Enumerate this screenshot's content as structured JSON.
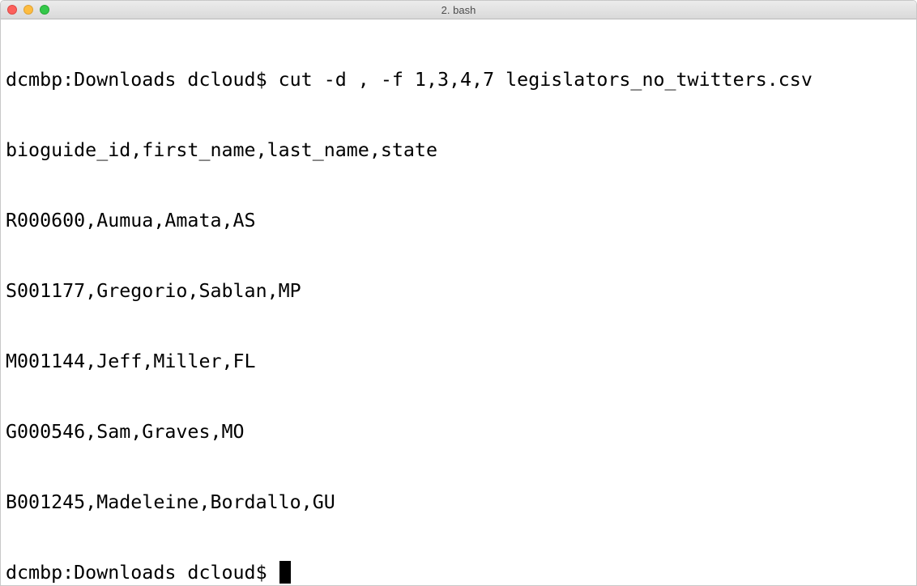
{
  "window": {
    "title": "2. bash"
  },
  "terminal": {
    "lines": [
      "dcmbp:Downloads dcloud$ cut -d , -f 1,3,4,7 legislators_no_twitters.csv",
      "bioguide_id,first_name,last_name,state",
      "R000600,Aumua,Amata,AS",
      "S001177,Gregorio,Sablan,MP",
      "M001144,Jeff,Miller,FL",
      "G000546,Sam,Graves,MO",
      "B001245,Madeleine,Bordallo,GU"
    ],
    "prompt": "dcmbp:Downloads dcloud$ "
  }
}
